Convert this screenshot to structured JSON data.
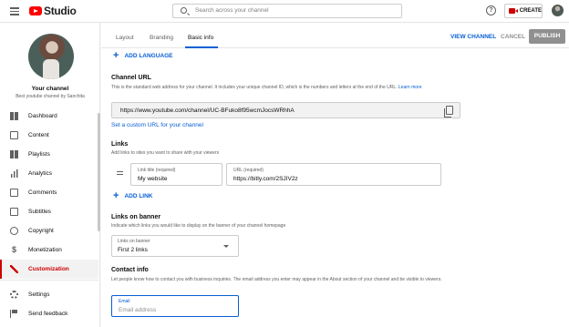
{
  "app": {
    "title": "Studio"
  },
  "search": {
    "placeholder": "Search across your channel"
  },
  "header": {
    "help_icon": "help-circle-icon",
    "create_label": "CREATE"
  },
  "sidebar": {
    "channel_title": "Your channel",
    "channel_subtitle": "Best youtube channel by Sanchita",
    "items": [
      {
        "label": "Dashboard",
        "icon": "dashboard-icon"
      },
      {
        "label": "Content",
        "icon": "content-icon"
      },
      {
        "label": "Playlists",
        "icon": "playlists-icon"
      },
      {
        "label": "Analytics",
        "icon": "analytics-icon"
      },
      {
        "label": "Comments",
        "icon": "comments-icon"
      },
      {
        "label": "Subtitles",
        "icon": "subtitles-icon"
      },
      {
        "label": "Copyright",
        "icon": "copyright-icon"
      },
      {
        "label": "Monetization",
        "icon": "monetization-icon"
      },
      {
        "label": "Customization",
        "icon": "customization-icon",
        "active": true
      }
    ],
    "bottom_items": [
      {
        "label": "Settings",
        "icon": "gear-icon"
      },
      {
        "label": "Send feedback",
        "icon": "feedback-icon"
      }
    ]
  },
  "tabs": [
    "Layout",
    "Branding",
    "Basic info"
  ],
  "actions": {
    "view_channel": "VIEW CHANNEL",
    "cancel": "CANCEL",
    "publish": "PUBLISH"
  },
  "add_language": "ADD LANGUAGE",
  "channel_url": {
    "title": "Channel URL",
    "desc": "This is the standard web address for your channel. It includes your unique channel ID, which is the numbers and letters at the end of the URL.",
    "learn_more": "Learn more",
    "value": "https://www.youtube.com/channel/UC-BFuko8f95wcmJocsWRhhA",
    "custom_url_link": "Set a custom URL for your channel"
  },
  "links": {
    "title": "Links",
    "desc": "Add links to sites you want to share with your viewers",
    "title_label": "Link title (required)",
    "title_value": "My website",
    "url_label": "URL (required)",
    "url_value": "https://bitly.com/2SJIV2z",
    "add_link": "ADD LINK"
  },
  "links_on_banner": {
    "title": "Links on banner",
    "desc": "Indicate which links you would like to display on the banner of your channel homepage",
    "select_label": "Links on banner",
    "select_value": "First 2 links"
  },
  "contact": {
    "title": "Contact info",
    "desc": "Let people know how to contact you with business inquiries. The email address you enter may appear in the About section of your channel and be visible to viewers.",
    "email_label": "Email",
    "email_placeholder": "Email address"
  },
  "colors": {
    "accent": "#065fd4",
    "brand": "#ff0000",
    "active_nav": "#cc0000"
  }
}
